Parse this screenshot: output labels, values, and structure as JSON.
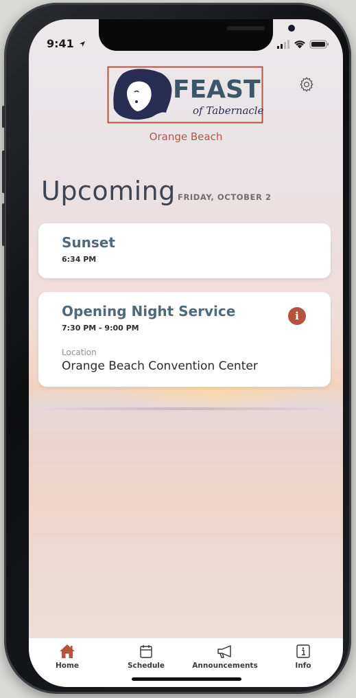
{
  "status_bar": {
    "time": "9:41"
  },
  "header": {
    "logo_word_1": "FEAST",
    "logo_word_2": "of Tabernacles",
    "location": "Orange Beach"
  },
  "upcoming": {
    "title": "Upcoming",
    "date": "FRIDAY, OCTOBER 2"
  },
  "events": [
    {
      "title": "Sunset",
      "time": "6:34 PM"
    },
    {
      "title": "Opening Night Service",
      "time": "7:30 PM - 9:00 PM",
      "location_label": "Location",
      "location": "Orange Beach Convention Center"
    }
  ],
  "tabs": [
    {
      "label": "Home",
      "icon": "home-icon",
      "active": true
    },
    {
      "label": "Schedule",
      "icon": "calendar-icon"
    },
    {
      "label": "Announcements",
      "icon": "megaphone-icon"
    },
    {
      "label": "Info",
      "icon": "info-icon"
    }
  ],
  "colors": {
    "accent": "#b4543f",
    "event_title": "#4d6a7d",
    "logo_blue": "#3c5667",
    "logo_navy": "#2a2d52"
  }
}
